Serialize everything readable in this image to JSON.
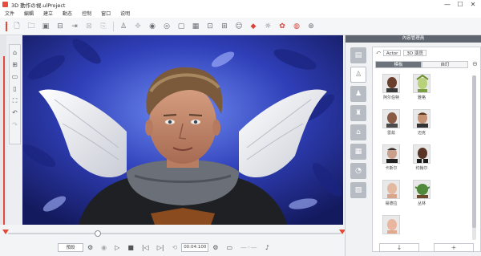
{
  "window": {
    "title": "3D 動作の視.ulProject",
    "buttons": [
      "—",
      "☐",
      "✕"
    ]
  },
  "menu": [
    "文件",
    "編輯",
    "建立",
    "動态",
    "控制",
    "窗口",
    "说明"
  ],
  "toolbar_icons": [
    "new-file-icon",
    "open-folder-icon",
    "save-icon",
    "export-icon",
    "import-icon",
    "undo-icon",
    "actor-icon",
    "move-icon",
    "eye-icon",
    "camera-icon",
    "checker-icon",
    "capture-icon",
    "record-icon",
    "mask-icon",
    "light-icon",
    "effects-icon",
    "bg-icon"
  ],
  "left_tools": [
    "home-icon",
    "fit-icon",
    "frame-icon",
    "aspect-icon",
    "fullscreen-icon",
    "undo-icon",
    "redo-icon"
  ],
  "timeline": {
    "mode_button": "預設",
    "time_display": "00:04:100",
    "progress": 0.27
  },
  "panel": {
    "header": "內容管理員",
    "path": {
      "root": "Actor",
      "sub": "3D 演员"
    },
    "subtabs": [
      "模板",
      "自訂"
    ],
    "selected_subtab": "模板",
    "characters": [
      {
        "name": "阿尔伯特",
        "kind": "man-dark"
      },
      {
        "name": "雅格",
        "kind": "plant"
      },
      {
        "name": "雷兹",
        "kind": "bald-man"
      },
      {
        "name": "迈克",
        "kind": "man"
      },
      {
        "name": "卡斯尔",
        "kind": "man-suit"
      },
      {
        "name": "约翰尔",
        "kind": "man-dark-suit"
      },
      {
        "name": "易德拉",
        "kind": "girl-bald"
      },
      {
        "name": "丛林",
        "kind": "orc"
      },
      {
        "name": "",
        "kind": "baby"
      }
    ],
    "bottom_buttons": [
      "↓",
      "+"
    ]
  }
}
